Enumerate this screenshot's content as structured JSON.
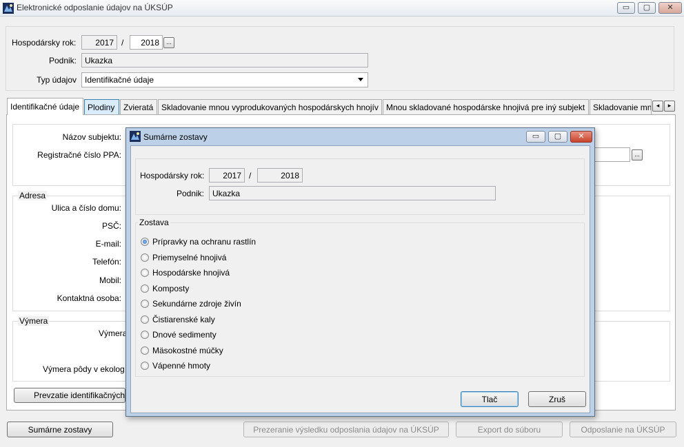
{
  "window": {
    "title": "Elektronické odposlanie údajov na ÚKSÚP",
    "controls": {
      "minimize": "▭",
      "maximize": "▢",
      "close": "✕"
    }
  },
  "header": {
    "year_label": "Hospodársky rok:",
    "year_from": "2017",
    "year_sep": "/",
    "year_to": "2018",
    "year_picker": "...",
    "company_label": "Podnik:",
    "company_value": "Ukazka",
    "type_label": "Typ údajov",
    "type_value": "Identifikačné údaje"
  },
  "tabs": [
    {
      "label": "Identifikačné údaje"
    },
    {
      "label": "Plodiny"
    },
    {
      "label": "Zvieratá"
    },
    {
      "label": "Skladovanie mnou vyprodukovaných hospodárskych hnojív"
    },
    {
      "label": "Mnou skladované hospodárske hnojivá pre iný subjekt"
    },
    {
      "label": "Skladovanie mn"
    }
  ],
  "tab_scroll": {
    "left": "◂",
    "right": "▸"
  },
  "identification": {
    "subject_name_label": "Názov subjektu:",
    "ppa_label": "Registračné číslo PPA:",
    "ppa_picker": "...",
    "address_group": "Adresa",
    "street_label": "Ulica a číslo domu:",
    "psc_label": "PSČ:",
    "email_label": "E-mail:",
    "phone_label": "Telefón:",
    "mobile_label": "Mobil:",
    "contact_label": "Kontaktná osoba:",
    "area_group": "Výmera",
    "area_label": "Výmera",
    "eco_area_label": "Výmera pôdy v ekolog",
    "import_button": "Prevzatie identifikačných"
  },
  "footer": {
    "summary_button": "Sumárne zostavy",
    "review_button": "Prezeranie výsledku odposlania údajov na ÚKSÚP",
    "export_button": "Export do súboru",
    "send_button": "Odposlanie na ÚKSÚP"
  },
  "dialog": {
    "title": "Sumárne zostavy",
    "year_label": "Hospodársky rok:",
    "year_from": "2017",
    "year_sep": "/",
    "year_to": "2018",
    "company_label": "Podnik:",
    "company_value": "Ukazka",
    "report_group": "Zostava",
    "options": [
      {
        "label": "Prípravky na ochranu rastlín",
        "checked": true
      },
      {
        "label": "Priemyselné hnojivá",
        "checked": false
      },
      {
        "label": "Hospodárske hnojivá",
        "checked": false
      },
      {
        "label": "Komposty",
        "checked": false
      },
      {
        "label": "Sekundárne zdroje živín",
        "checked": false
      },
      {
        "label": "Čistiarenské kaly",
        "checked": false
      },
      {
        "label": "Dnové sedimenty",
        "checked": false
      },
      {
        "label": "Mäsokostné múčky",
        "checked": false
      },
      {
        "label": "Vápenné hmoty",
        "checked": false
      }
    ],
    "print_button": "Tlač",
    "cancel_button": "Zruš"
  }
}
